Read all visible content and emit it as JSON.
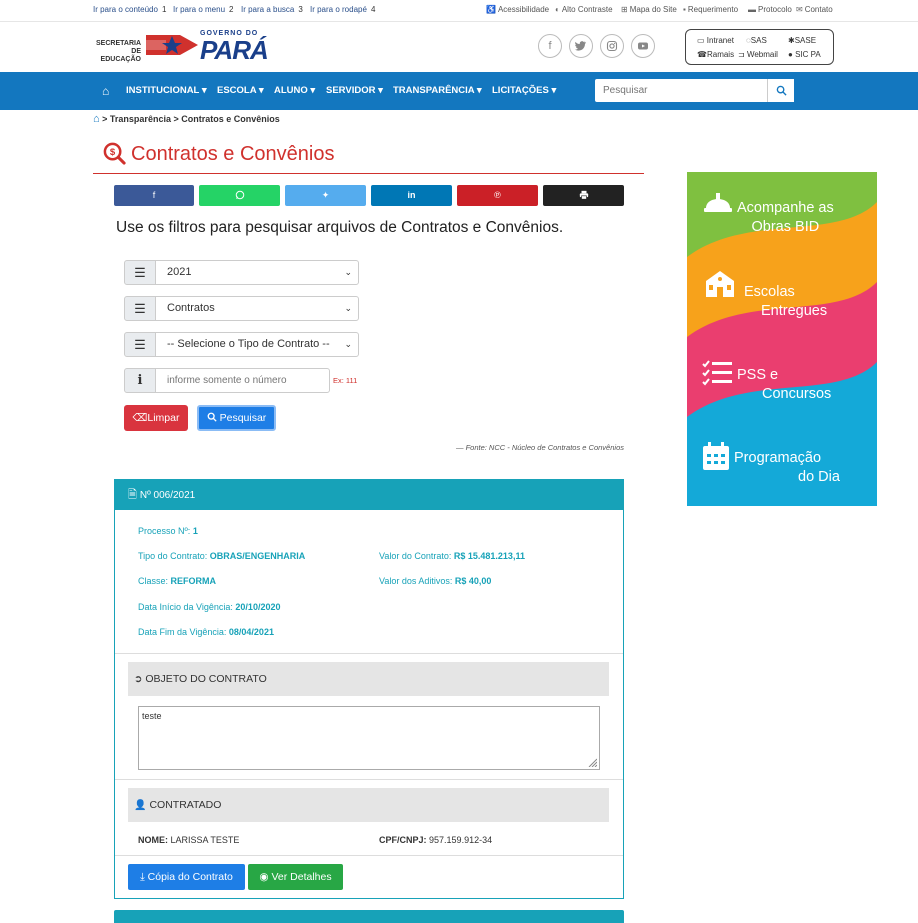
{
  "topbar": {
    "skip_links": [
      {
        "label": "Ir para o conteúdo",
        "key": "1"
      },
      {
        "label": "Ir para o menu",
        "key": "2"
      },
      {
        "label": "Ir para a busca",
        "key": "3"
      },
      {
        "label": "Ir para o rodapé",
        "key": "4"
      }
    ],
    "utilities": [
      "Acessibilidade",
      "Alto Contraste",
      "Mapa do Site",
      "Requerimento",
      "Protocolo",
      "Contato"
    ]
  },
  "header": {
    "logo_secretaria_line1": "SECRETARIA DE",
    "logo_secretaria_line2": "EDUCAÇÃO",
    "logo_governo": "GOVERNO DO",
    "logo_para": "PARÁ",
    "social_icons": [
      "facebook-icon",
      "twitter-icon",
      "instagram-icon",
      "youtube-icon"
    ],
    "systems": [
      "Intranet",
      "SAS",
      "SASE",
      "Ramais",
      "Webmail",
      "SIC PA"
    ]
  },
  "nav": {
    "items": [
      "INSTITUCIONAL",
      "ESCOLA",
      "ALUNO",
      "SERVIDOR",
      "TRANSPARÊNCIA",
      "LICITAÇÕES"
    ],
    "search_placeholder": "Pesquisar"
  },
  "breadcrumb": {
    "items": [
      "Transparência",
      "Contratos e Convênios"
    ]
  },
  "page": {
    "title": "Contratos e Convênios",
    "filter_instructions": "Use os filtros para pesquisar arquivos de Contratos e Convênios."
  },
  "share": [
    "facebook-icon",
    "whatsapp-icon",
    "twitter-icon",
    "linkedin-icon",
    "pinterest-icon",
    "print-icon"
  ],
  "filters": {
    "year": "2021",
    "category": "Contratos",
    "contract_type": "-- Selecione o Tipo de Contrato --",
    "number_placeholder": "informe somente o número",
    "number_hint": "Ex: 111",
    "clear_label": "Limpar",
    "search_label": "Pesquisar",
    "source_note": "— Fonte: NCC - Núcleo de Contratos e Convênios"
  },
  "contract": {
    "header": "Nº 006/2021",
    "processo_label": "Processo Nº:",
    "processo_value": "1",
    "tipo_label": "Tipo do Contrato:",
    "tipo_value": "OBRAS/ENGENHARIA",
    "valor_label": "Valor do Contrato:",
    "valor_value": "R$ 15.481.213,11",
    "classe_label": "Classe:",
    "classe_value": "REFORMA",
    "aditivos_label": "Valor dos Aditivos:",
    "aditivos_value": "R$ 40,00",
    "inicio_label": "Data Início da Vigência:",
    "inicio_value": "20/10/2020",
    "fim_label": "Data Fim da Vigência:",
    "fim_value": "08/04/2021",
    "objeto_title": "OBJETO DO CONTRATO",
    "objeto_text": "teste",
    "contratado_title": "CONTRATADO",
    "nome_label": "NOME:",
    "nome_value": "LARISSA TESTE",
    "cpf_label": "CPF/CNPJ:",
    "cpf_value": "957.159.912-34",
    "copy_label": "Cópia do Contrato",
    "details_label": "Ver Detalhes"
  },
  "banner": {
    "items": [
      {
        "line1": "Acompanhe as",
        "line2": "Obras BID",
        "icon": "helmet-icon"
      },
      {
        "line1": "Escolas",
        "line2": "Entregues",
        "icon": "school-icon"
      },
      {
        "line1": "PSS e",
        "line2": "Concursos",
        "icon": "checklist-icon"
      },
      {
        "line1": "Programação",
        "line2": "do Dia",
        "icon": "calendar-icon"
      }
    ]
  },
  "colors": {
    "nav_blue": "#1377bf",
    "title_red": "#d0312d",
    "teal": "#17a2b8",
    "danger": "#d9343e",
    "primary": "#1e7ee6",
    "success": "#28a745"
  }
}
